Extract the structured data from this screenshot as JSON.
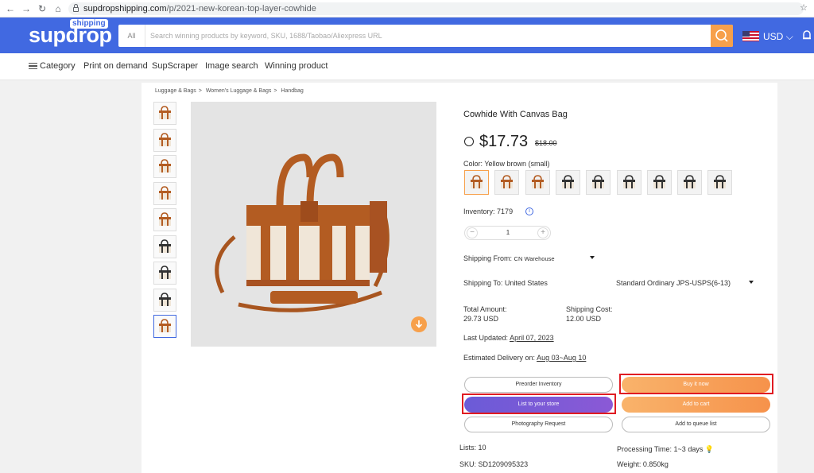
{
  "browser": {
    "url_host": "supdropshipping.com",
    "url_path": "/p/2021-new-korean-top-layer-cowhide"
  },
  "header": {
    "logo_text": "supdrop",
    "logo_tag": "shipping",
    "search_scope": "All",
    "search_placeholder": "Search winning products by keyword, SKU, 1688/Taobao/Aliexpress URL",
    "currency": "USD",
    "brand_color": "#4169e1",
    "accent_color": "#f7a04b"
  },
  "nav": {
    "items": [
      "Category",
      "Print on demand",
      "SupScraper",
      "Image search",
      "Winning product"
    ]
  },
  "breadcrumb": [
    "Luggage & Bags",
    "Women's Luggage & Bags",
    "Handbag"
  ],
  "product": {
    "title": "Cowhide With Canvas Bag",
    "price": "$17.73",
    "original_price": "$18.00",
    "color_label": "Color:",
    "color_value": "Yellow brown (small)",
    "swatch_count": 9,
    "inventory_label": "Inventory:",
    "inventory_value": "7179",
    "quantity": "1",
    "shipping_from_label": "Shipping From:",
    "shipping_from_value": "CN Warehouse",
    "shipping_to_label": "Shipping To:",
    "shipping_to_value": "United States",
    "shipping_method": "Standard Ordinary JPS-USPS(6-13)",
    "total_amount_label": "Total Amount:",
    "total_amount_value": "29.73 USD",
    "shipping_cost_label": "Shipping Cost:",
    "shipping_cost_value": "12.00 USD",
    "last_updated_label": "Last Updated:",
    "last_updated_value": "April 07, 2023",
    "delivery_label": "Estimated Delivery on:",
    "delivery_value": "Aug 03~Aug 10",
    "lists_label": "Lists:",
    "lists_value": "10",
    "processing_label": "Processing Time:",
    "processing_value": "1~3 days",
    "sku_label": "SKU:",
    "sku_value": "SD1209095323",
    "weight_label": "Weight:",
    "weight_value": "0.850kg"
  },
  "buttons": {
    "preorder": "Preorder Inventory",
    "buy_now": "Buy it now",
    "list_to_store": "List to your store",
    "add_to_cart": "Add to cart",
    "photography": "Photography Request",
    "add_to_queue": "Add to queue list"
  },
  "thumbnail_count": 9
}
